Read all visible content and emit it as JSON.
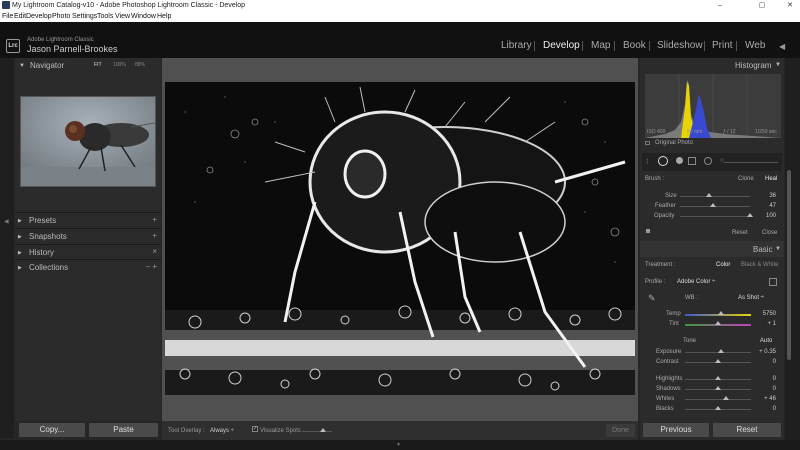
{
  "window": {
    "title": "My Lightroom Catalog-v10 - Adobe Photoshop Lightroom Classic - Develop",
    "controls": [
      "–",
      "▢",
      "✕"
    ]
  },
  "menu": [
    "File",
    "Edit",
    "Develop",
    "Photo",
    "Settings",
    "Tools",
    "View",
    "Window",
    "Help"
  ],
  "identity": {
    "logo": "Lrc",
    "app_name": "Adobe Lightroom Classic",
    "user_name": "Jason Parnell-Brookes"
  },
  "modules": [
    {
      "label": "Library",
      "active": false
    },
    {
      "label": "Develop",
      "active": true
    },
    {
      "label": "Map",
      "active": false
    },
    {
      "label": "Book",
      "active": false
    },
    {
      "label": "Slideshow",
      "active": false
    },
    {
      "label": "Print",
      "active": false
    },
    {
      "label": "Web",
      "active": false
    }
  ],
  "navigator": {
    "title": "Navigator",
    "zoom_options": [
      "FIT",
      "100%",
      "88%"
    ]
  },
  "left_sections": [
    {
      "label": "Presets",
      "action": "+"
    },
    {
      "label": "Snapshots",
      "action": "+"
    },
    {
      "label": "History",
      "action": "×"
    },
    {
      "label": "Collections",
      "action": "– +"
    }
  ],
  "left_buttons": {
    "copy": "Copy...",
    "paste": "Paste"
  },
  "toolbar": {
    "overlay_label": "Tool Overlay :",
    "overlay_value": "Always ÷",
    "visualize_label": "Visualize Spots",
    "done": "Done"
  },
  "histogram": {
    "title": "Histogram",
    "iso": "ISO 400",
    "focal": "50 mm",
    "aperture": "ƒ / 12",
    "shutter": "1/250 sec",
    "original_label": "Original Photo"
  },
  "brush": {
    "label": "Brush :",
    "modes": [
      "Clone",
      "Heal"
    ],
    "active_mode": "Heal",
    "sliders": [
      {
        "label": "Size",
        "value": "36",
        "pos": 0.42
      },
      {
        "label": "Feather",
        "value": "47",
        "pos": 0.47
      },
      {
        "label": "Opacity",
        "value": "100",
        "pos": 1.0
      }
    ],
    "reset": "Reset",
    "close": "Close"
  },
  "basic": {
    "title": "Basic",
    "treatment_label": "Treatment :",
    "treatment_options": [
      "Color",
      "Black & White"
    ],
    "profile_label": "Profile :",
    "profile_value": "Adobe Color ÷",
    "wb_label": "WB :",
    "wb_value": "As Shot ÷",
    "temp": {
      "label": "Temp",
      "value": "5750",
      "pos": 0.55
    },
    "tint": {
      "label": "Tint",
      "value": "+ 1",
      "pos": 0.5
    },
    "tone_label": "Tone",
    "auto": "Auto",
    "sliders": [
      {
        "label": "Exposure",
        "value": "+ 0.35",
        "pos": 0.54
      },
      {
        "label": "Contrast",
        "value": "0",
        "pos": 0.5
      },
      {
        "label": "Highlights",
        "value": "0",
        "pos": 0.5
      },
      {
        "label": "Shadows",
        "value": "0",
        "pos": 0.5
      },
      {
        "label": "Whites",
        "value": "+ 46",
        "pos": 0.62
      },
      {
        "label": "Blacks",
        "value": "0",
        "pos": 0.5
      }
    ]
  },
  "right_buttons": {
    "previous": "Previous",
    "reset": "Reset"
  },
  "colors": {
    "bg": "#262626",
    "panel": "#2b2b2b",
    "topbar": "#111111",
    "accent_yellow": "#e8d400",
    "accent_blue": "#3a4ad0"
  }
}
